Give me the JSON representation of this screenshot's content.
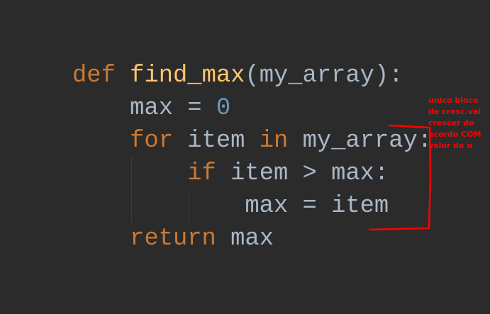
{
  "editor": {
    "colors": {
      "background": "#2b2b2b",
      "keyword": "#cc7832",
      "function": "#ffc66d",
      "text": "#a9b7c6",
      "number": "#6897bb"
    },
    "lines": [
      {
        "indent": 0,
        "tokens": [
          {
            "t": "def",
            "c": "kw"
          },
          {
            "t": " ",
            "c": "tx"
          },
          {
            "t": "find_max",
            "c": "fn"
          },
          {
            "t": "(my_array):",
            "c": "tx"
          }
        ]
      },
      {
        "indent": 1,
        "tokens": [
          {
            "t": "max = ",
            "c": "tx"
          },
          {
            "t": "0",
            "c": "num"
          }
        ]
      },
      {
        "indent": 1,
        "tokens": [
          {
            "t": "for",
            "c": "kw"
          },
          {
            "t": " item ",
            "c": "tx"
          },
          {
            "t": "in",
            "c": "kw"
          },
          {
            "t": " my_array:",
            "c": "tx"
          }
        ]
      },
      {
        "indent": 2,
        "tokens": [
          {
            "t": "if",
            "c": "kw"
          },
          {
            "t": " item > max:",
            "c": "tx"
          }
        ]
      },
      {
        "indent": 3,
        "tokens": [
          {
            "t": "max = item",
            "c": "tx"
          }
        ]
      },
      {
        "indent": 1,
        "tokens": [
          {
            "t": "return",
            "c": "kw"
          },
          {
            "t": " max",
            "c": "tx"
          }
        ]
      }
    ]
  },
  "annotation": {
    "text_lines": [
      "unico bloco",
      "de cresc.vai",
      "crescer de",
      "acordo COM",
      "valor de n"
    ],
    "color": "#ff0000"
  }
}
